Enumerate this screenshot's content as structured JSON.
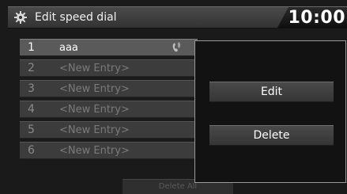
{
  "header": {
    "icon": "gear-icon",
    "title": "Edit speed dial",
    "clock": "10:00"
  },
  "entries": [
    {
      "number": "1",
      "name": "aaa",
      "icon": "phone-voice-tag-icon",
      "selected": true
    },
    {
      "number": "2",
      "name": "<New Entry>"
    },
    {
      "number": "3",
      "name": "<New Entry>"
    },
    {
      "number": "4",
      "name": "<New Entry>"
    },
    {
      "number": "5",
      "name": "<New Entry>"
    },
    {
      "number": "6",
      "name": "<New Entry>"
    }
  ],
  "footer": {
    "delete_all_label": "Delete All"
  },
  "popup": {
    "edit_label": "Edit",
    "delete_label": "Delete"
  }
}
